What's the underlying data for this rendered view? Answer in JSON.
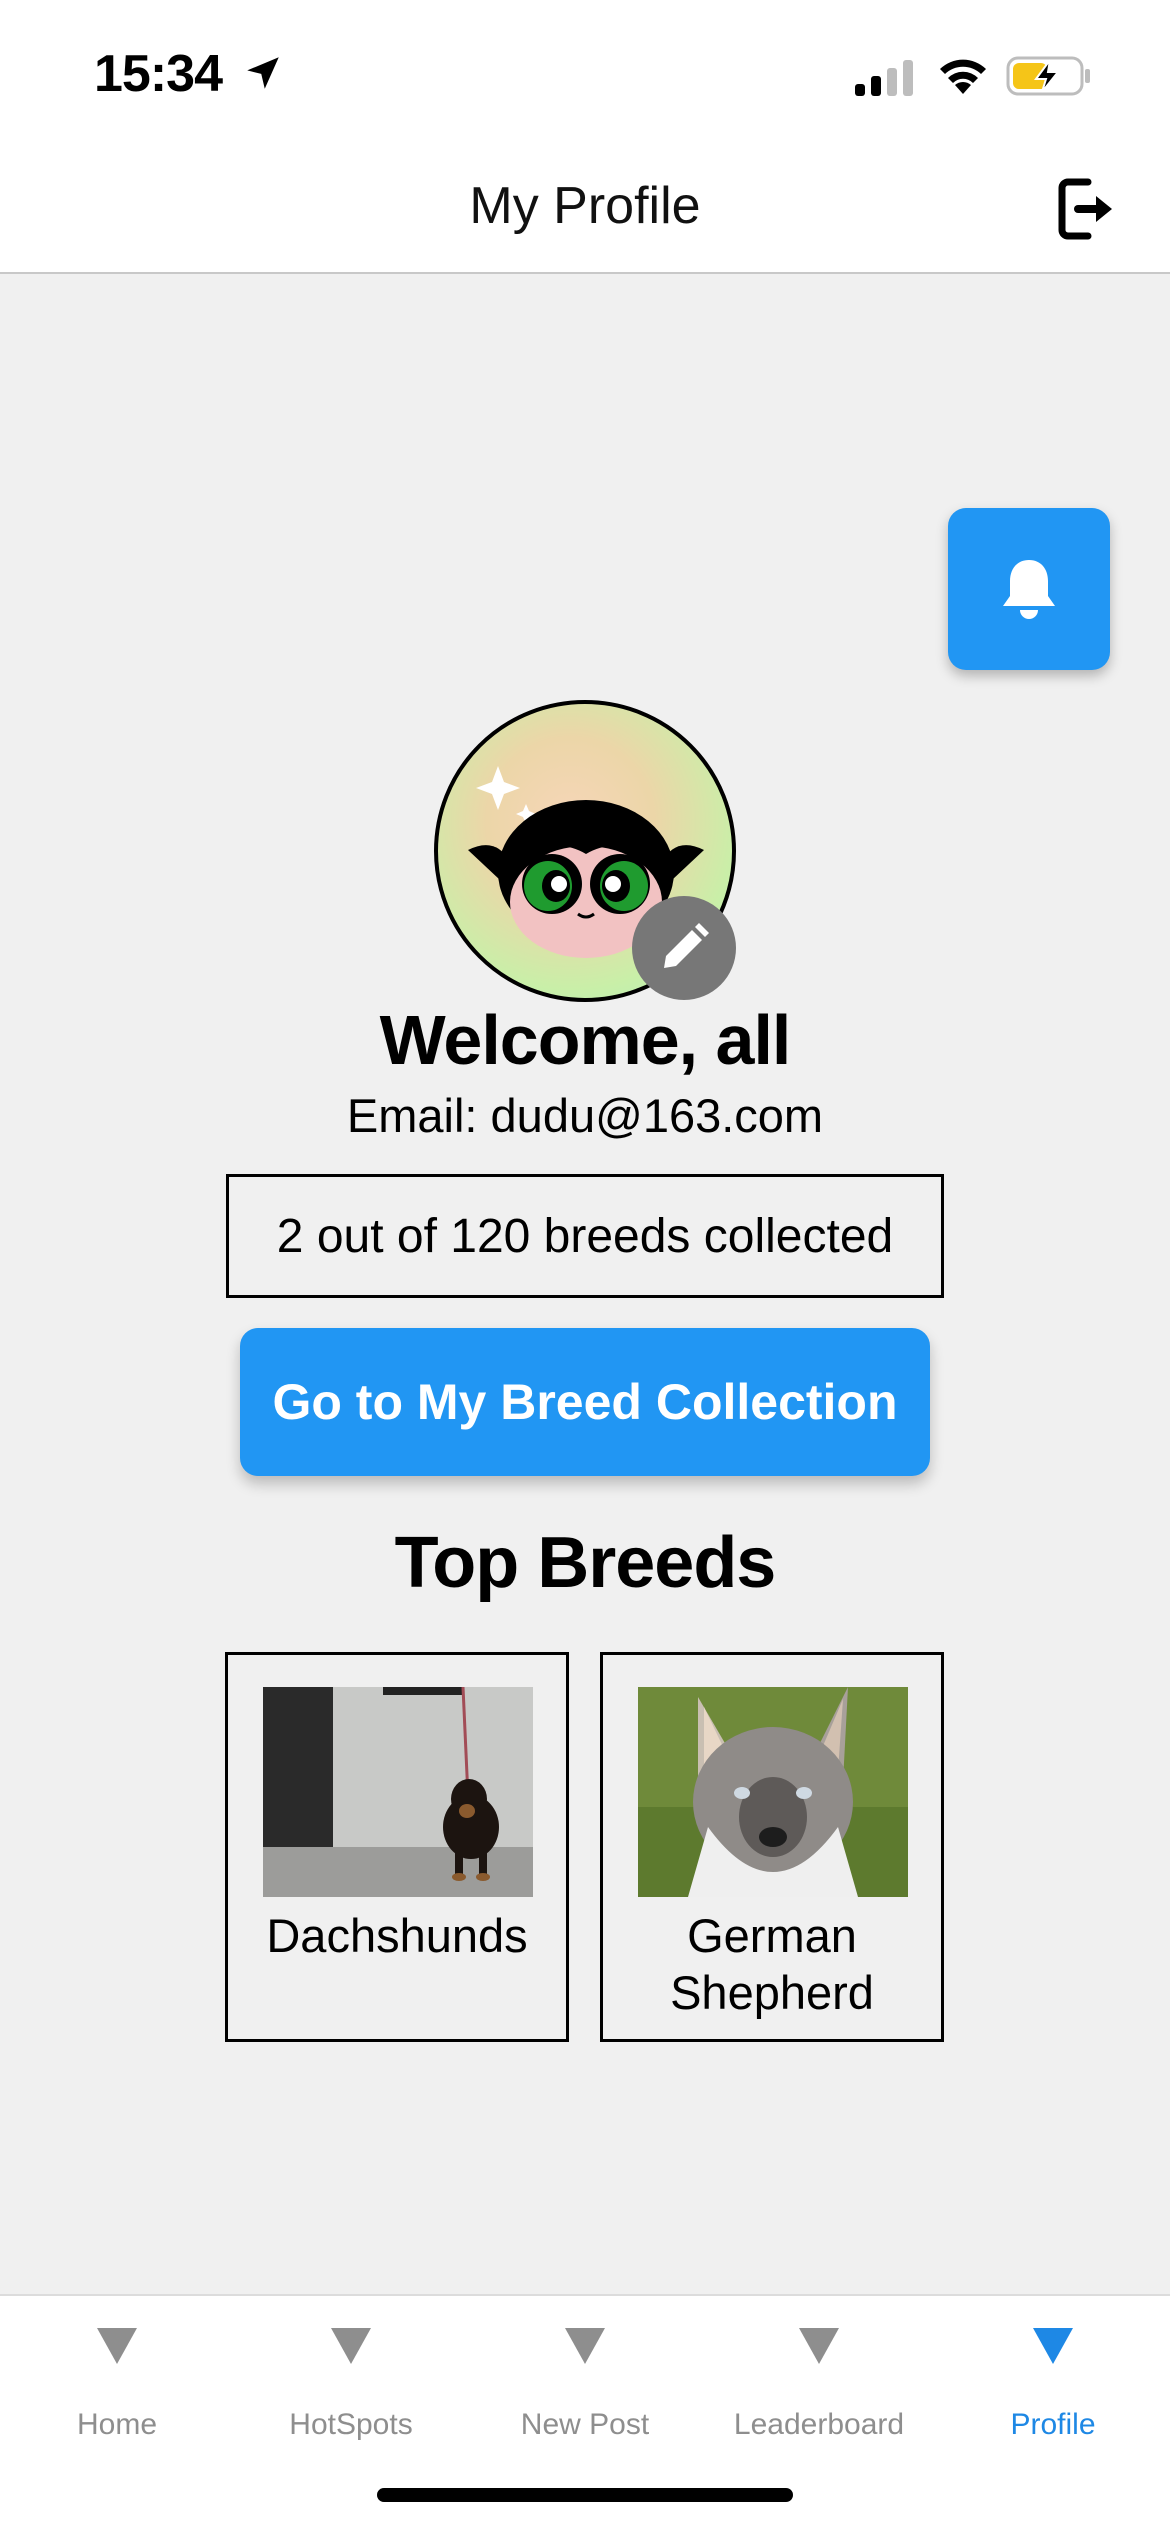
{
  "status_bar": {
    "time": "15:34",
    "icons": [
      "location-arrow-icon",
      "cellular-signal-icon",
      "wifi-icon",
      "battery-charging-icon"
    ]
  },
  "header": {
    "title": "My Profile",
    "logout_icon": "logout-icon"
  },
  "notifications": {
    "icon": "bell-icon"
  },
  "profile": {
    "avatar_alt": "avatar",
    "edit_icon": "pencil-icon",
    "welcome": "Welcome, all",
    "email": "Email: dudu@163.com",
    "collected_summary": "2 out of 120 breeds collected",
    "collection_button": "Go to My Breed Collection"
  },
  "top_breeds": {
    "title": "Top Breeds",
    "items": [
      {
        "name": "Dachshunds"
      },
      {
        "name": "German Shepherd"
      }
    ]
  },
  "tab_bar": {
    "active": "Profile",
    "tabs": [
      {
        "label": "Home"
      },
      {
        "label": "HotSpots"
      },
      {
        "label": "New Post"
      },
      {
        "label": "Leaderboard"
      },
      {
        "label": "Profile"
      }
    ]
  },
  "colors": {
    "accent": "#2196f3",
    "active_tab": "#1e88e5",
    "inactive_tab": "#8e8e8e",
    "background": "#f0f0f0"
  }
}
